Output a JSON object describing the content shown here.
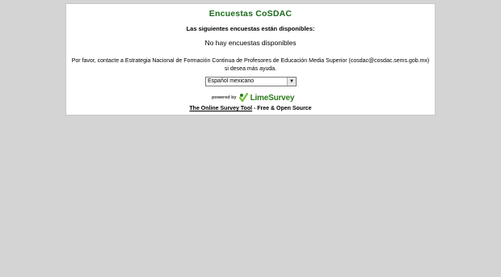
{
  "page": {
    "title": "Encuestas CoSDAC",
    "subtitle": "Las siguientes encuestas están disponibles:",
    "no_surveys": "No hay encuestas disponibles",
    "contact_text": "Por favor, contacte a Estrategia Nacional de Formación Continua de Profesores de Educación Media Superior (cosdac@cosdac.sems.gob.mx) si desea más ayuda."
  },
  "language_select": {
    "selected": "Español mexicano"
  },
  "powered": {
    "prefix": "powered by",
    "logo_text": "LimeSurvey",
    "logo_icon": "limesurvey-logo-icon",
    "logo_color": "#2d7a1f"
  },
  "footer": {
    "link_text": "The Online Survey Tool",
    "suffix": " - Free & Open Source"
  },
  "colors": {
    "background": "#d4d4d4",
    "panel": "#ffffff",
    "title": "#1a6b1a"
  }
}
